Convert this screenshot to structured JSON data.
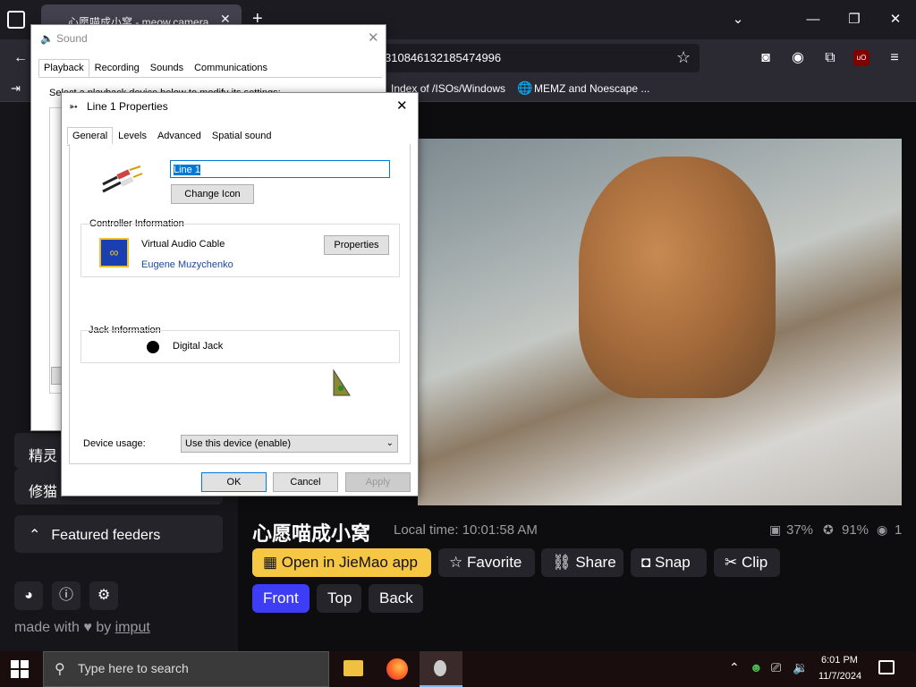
{
  "browser": {
    "tab_title": "心愿喵成小窝 - meow.camera",
    "url": "310846132185474996",
    "bookmarks": [
      "Index of /ISOs/Windows",
      "MEMZ and Noescape ..."
    ]
  },
  "sidebar": {
    "partial_items": [
      "精灵",
      "修猫"
    ],
    "featured_label": "Featured feeders",
    "footer_text": "made with ♥ by",
    "footer_link": "imput"
  },
  "stream": {
    "title": "心愿喵成小窝",
    "local_time": "Local time: 10:01:58 AM",
    "stat_food": "37%",
    "stat_cat": "91%",
    "stat_viewers": "1",
    "actions": [
      "Open in JieMao app",
      "Favorite",
      "Share",
      "Snap",
      "Clip"
    ],
    "cameras": [
      "Front",
      "Top",
      "Back"
    ]
  },
  "sound_dialog": {
    "title": "Sound",
    "tabs": [
      "Playback",
      "Recording",
      "Sounds",
      "Communications"
    ],
    "partial_text": "Select a playback device below to modify its settings:"
  },
  "props_dialog": {
    "title": "Line 1 Properties",
    "tabs": [
      "General",
      "Levels",
      "Advanced",
      "Spatial sound"
    ],
    "name_value": "Line 1",
    "change_icon": "Change Icon",
    "controller_header": "Controller Information",
    "controller_name": "Virtual Audio Cable",
    "controller_vendor": "Eugene Muzychenko",
    "properties_btn": "Properties",
    "jack_header": "Jack Information",
    "jack_name": "Digital Jack",
    "usage_label": "Device usage:",
    "usage_value": "Use this device (enable)",
    "ok": "OK",
    "cancel": "Cancel",
    "apply": "Apply"
  },
  "taskbar": {
    "search_placeholder": "Type here to search",
    "time": "6:01 PM",
    "date": "11/7/2024"
  },
  "colors": {
    "accent_yellow": "#f6c744",
    "accent_blue": "#3d3df5"
  }
}
